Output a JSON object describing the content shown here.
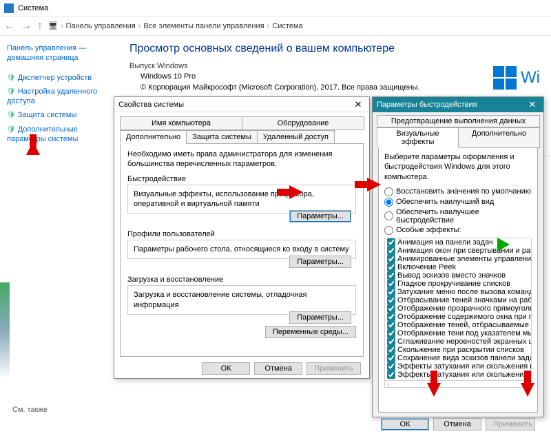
{
  "window": {
    "title": "Система"
  },
  "breadcrumb": [
    "Панель управления",
    "Все элементы панели управления",
    "Система"
  ],
  "sidebar": {
    "home": "Панель управления — домашняя страница",
    "links": [
      "Диспетчер устройств",
      "Настройка удаленного доступа",
      "Защита системы",
      "Дополнительные параметры системы"
    ]
  },
  "main": {
    "heading": "Просмотр основных сведений о вашем компьютере",
    "edition_label": "Выпуск Windows",
    "edition": "Windows 10 Pro",
    "copyright": "© Корпорация Майкрософт (Microsoft Corporation), 2017. Все права защищены.",
    "winlogo_text": "Wi"
  },
  "dlg1": {
    "title": "Свойства системы",
    "tabs_row1": [
      "Имя компьютера",
      "Оборудование"
    ],
    "tabs_row2": [
      "Дополнительно",
      "Защита системы",
      "Удаленный доступ"
    ],
    "active_tab": "Дополнительно",
    "intro": "Необходимо иметь права администратора для изменения большинства перечисленных параметров.",
    "groups": [
      {
        "title": "Быстродействие",
        "desc": "Визуальные эффекты, использование процессора, оперативной и виртуальной памяти",
        "btn": "Параметры..."
      },
      {
        "title": "Профили пользователей",
        "desc": "Параметры рабочего стола, относящиеся ко входу в систему",
        "btn": "Параметры..."
      },
      {
        "title": "Загрузка и восстановление",
        "desc": "Загрузка и восстановление системы, отладочная информация",
        "btn": "Параметры..."
      }
    ],
    "env_btn": "Переменные среды...",
    "ok": "ОК",
    "cancel": "Отмена",
    "apply": "Применить"
  },
  "dlg2": {
    "title": "Параметры быстродействия",
    "tabs_row1": [
      "Предотвращение выполнения данных"
    ],
    "tabs_row2": [
      "Визуальные эффекты",
      "Дополнительно"
    ],
    "active_tab": "Визуальные эффекты",
    "intro": "Выберите параметры оформления и быстродействия Windows для этого компьютера.",
    "radios": [
      "Восстановить значения по умолчанию",
      "Обеспечить наилучший вид",
      "Обеспечить наилучшее быстродействие",
      "Особые эффекты:"
    ],
    "selected_radio": 1,
    "effects": [
      "Анимация на панели задач",
      "Анимация окон при свертывании и развертывании",
      "Анимированные элементы управления и элементы внутри окна",
      "Включение Peek",
      "Вывод эскизов вместо значков",
      "Гладкое прокручивание списков",
      "Затухание меню после вызова команды",
      "Отбрасывание теней значками на рабочем столе",
      "Отображение прозрачного прямоугольника выделения",
      "Отображение содержимого окна при перетаскивании",
      "Отображение теней, отбрасываемые окнами",
      "Отображение тени под указателем мыши",
      "Сглаживание неровностей экранных шрифтов",
      "Скольжение при раскрытии списков",
      "Сохранение вида эскизов панели задач",
      "Эффекты затухания или скольжения при обращении к меню",
      "Эффекты затухания или скольжения при появлении подсказок"
    ],
    "ok": "ОК",
    "cancel": "Отмена",
    "apply": "Применить"
  },
  "footer": "См. также"
}
